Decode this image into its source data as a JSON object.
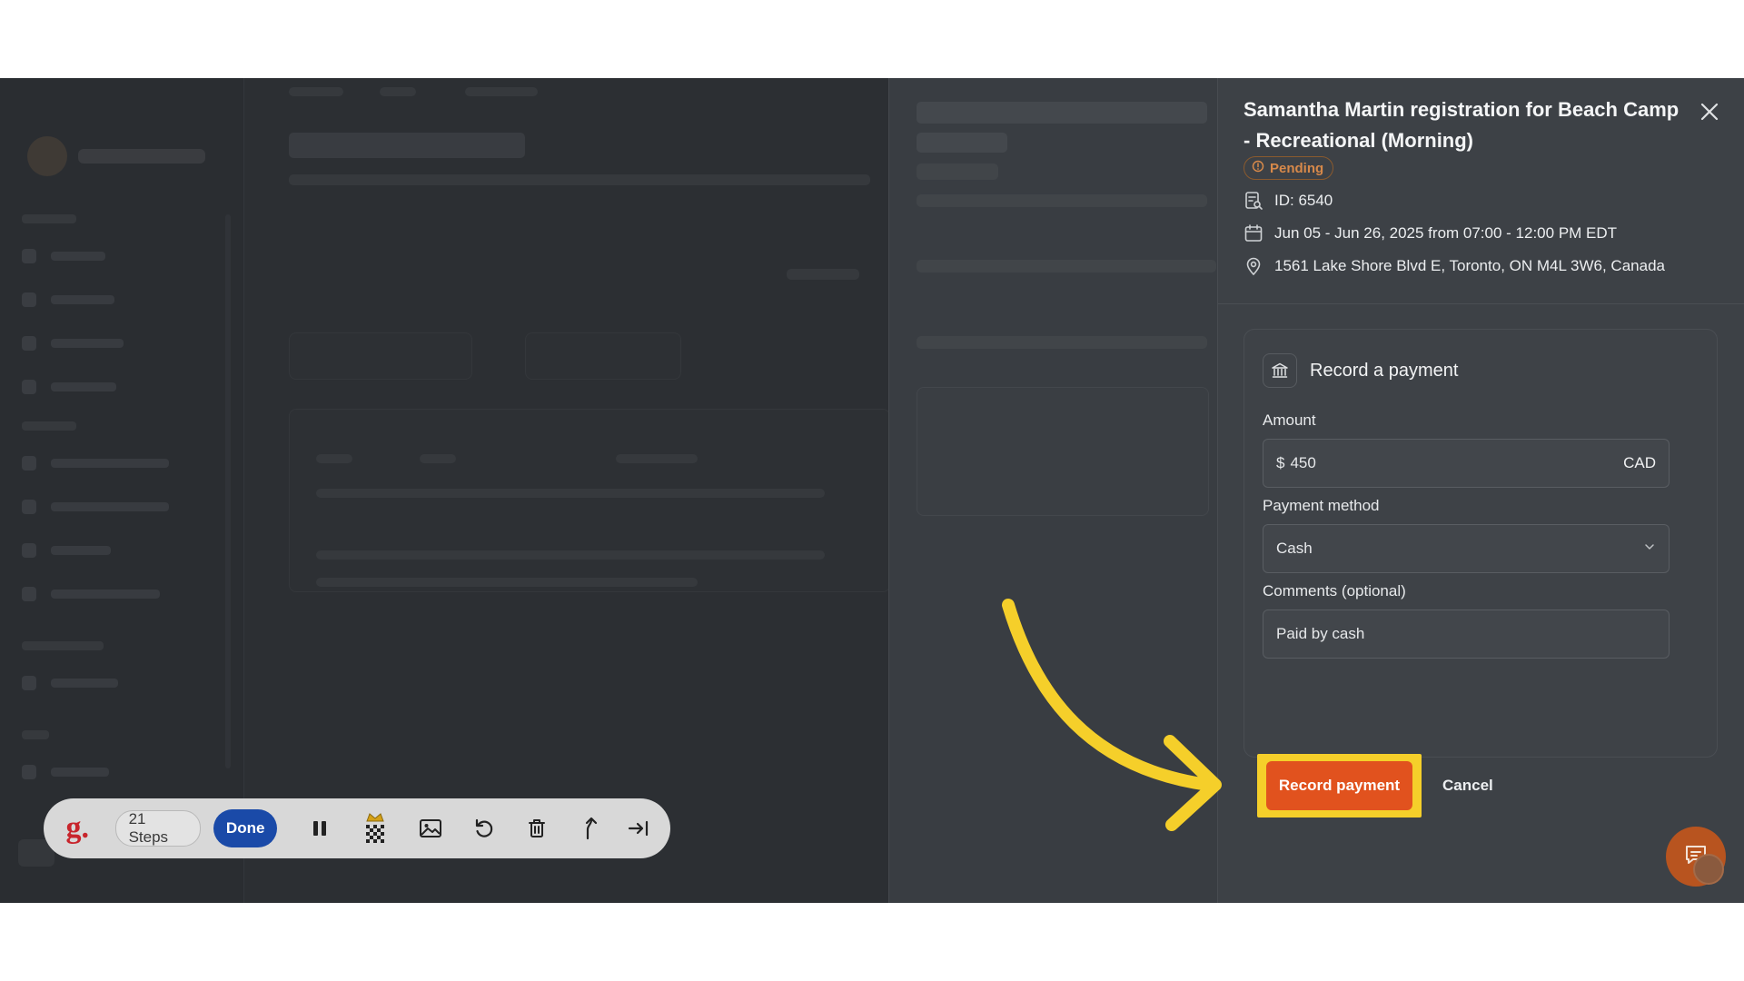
{
  "drawer": {
    "title": "Samantha Martin registration for Beach Camp - Recreational (Morning)",
    "status": "Pending",
    "id_text": "ID: 6540",
    "schedule": "Jun 05 - Jun 26, 2025 from 07:00 - 12:00 PM EDT",
    "address": "1561 Lake Shore Blvd E, Toronto, ON M4L 3W6, Canada",
    "close_icon": "close-icon"
  },
  "payment_form": {
    "heading": "Record a payment",
    "heading_icon": "bank-icon",
    "amount_label": "Amount",
    "currency_symbol": "$",
    "amount_value": "450",
    "currency": "CAD",
    "method_label": "Payment method",
    "method_value": "Cash",
    "comments_label": "Comments (optional)",
    "comments_value": "Paid by cash",
    "submit_label": "Record payment",
    "cancel_label": "Cancel"
  },
  "annotation": {
    "arrow_color": "#f5cf2a",
    "highlight_color": "#f5cf2a"
  },
  "toolbar": {
    "logo": "g.",
    "steps": "21 Steps",
    "done_label": "Done",
    "icons": [
      "pause-icon",
      "blur-crown-icon",
      "image-icon",
      "undo-icon",
      "trash-icon",
      "branch-icon",
      "skip-to-end-icon"
    ]
  },
  "colors": {
    "accent": "#e1521e",
    "done_button": "#1a4aa8",
    "pending": "#d7894a"
  }
}
